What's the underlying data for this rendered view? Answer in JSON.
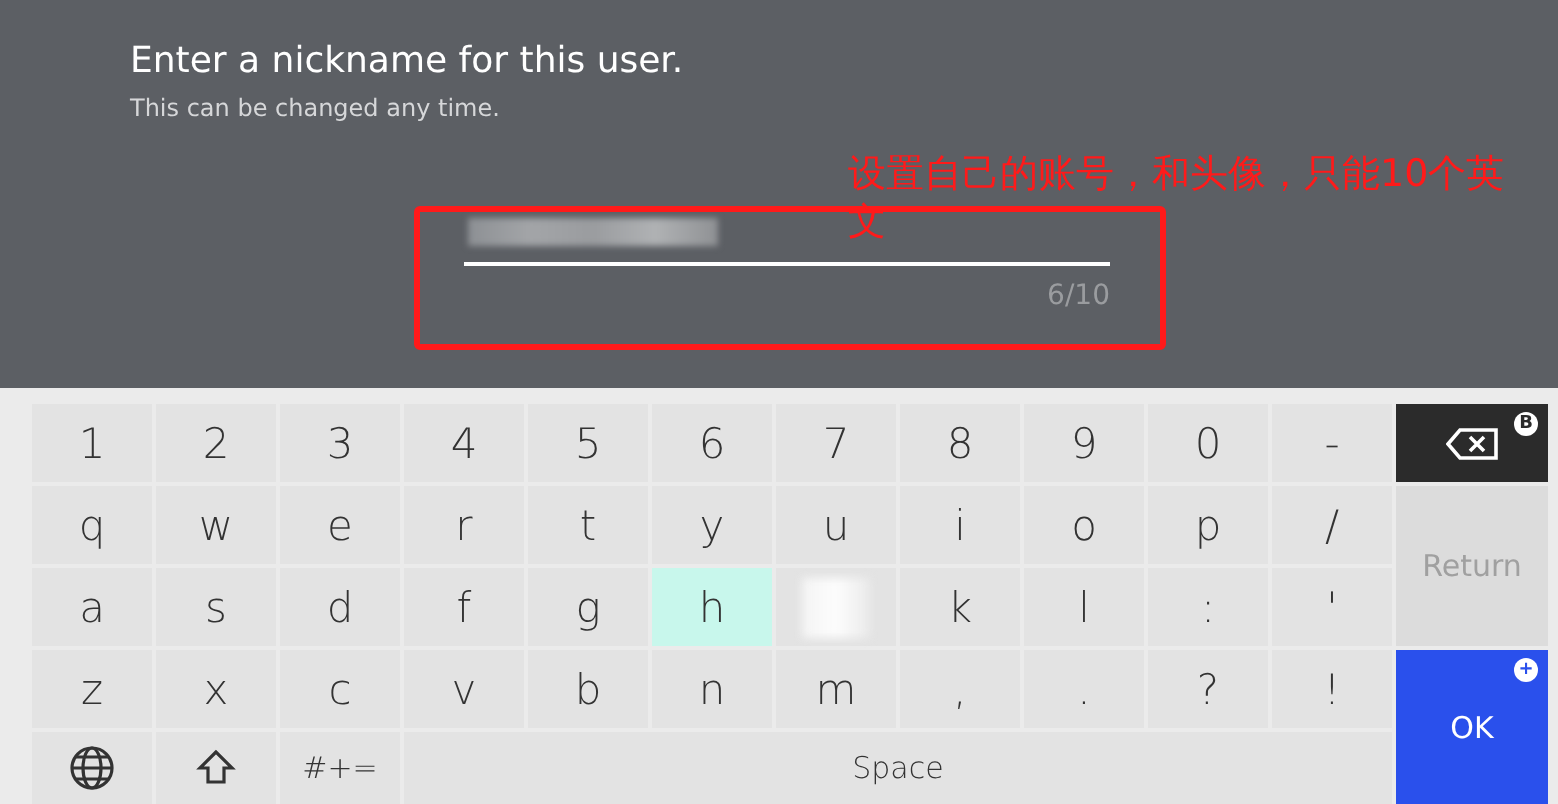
{
  "prompt": {
    "title": "Enter a nickname for this user.",
    "subtitle": "This can be changed any time."
  },
  "nickname_field": {
    "counter": "6/10"
  },
  "annotation": {
    "text": "设置自己的账号，和头像，只能10个英文"
  },
  "keyboard": {
    "rows": [
      [
        {
          "label": "1",
          "selected": false
        },
        {
          "label": "2",
          "selected": false
        },
        {
          "label": "3",
          "selected": false
        },
        {
          "label": "4",
          "selected": false
        },
        {
          "label": "5",
          "selected": false
        },
        {
          "label": "6",
          "selected": false
        },
        {
          "label": "7",
          "selected": false
        },
        {
          "label": "8",
          "selected": false
        },
        {
          "label": "9",
          "selected": false
        },
        {
          "label": "0",
          "selected": false
        },
        {
          "label": "-",
          "selected": false
        }
      ],
      [
        {
          "label": "q",
          "selected": false
        },
        {
          "label": "w",
          "selected": false
        },
        {
          "label": "e",
          "selected": false
        },
        {
          "label": "r",
          "selected": false
        },
        {
          "label": "t",
          "selected": false
        },
        {
          "label": "y",
          "selected": false
        },
        {
          "label": "u",
          "selected": false
        },
        {
          "label": "i",
          "selected": false
        },
        {
          "label": "o",
          "selected": false
        },
        {
          "label": "p",
          "selected": false
        },
        {
          "label": "/",
          "selected": false
        }
      ],
      [
        {
          "label": "a",
          "selected": false
        },
        {
          "label": "s",
          "selected": false
        },
        {
          "label": "d",
          "selected": false
        },
        {
          "label": "f",
          "selected": false
        },
        {
          "label": "g",
          "selected": false
        },
        {
          "label": "h",
          "selected": true
        },
        {
          "selected": false
        },
        {
          "label": "k",
          "selected": false
        },
        {
          "label": "l",
          "selected": false
        },
        {
          "label": ":",
          "selected": false
        },
        {
          "label": "'",
          "selected": false
        }
      ],
      [
        {
          "label": "z",
          "selected": false
        },
        {
          "label": "x",
          "selected": false
        },
        {
          "label": "c",
          "selected": false
        },
        {
          "label": "v",
          "selected": false
        },
        {
          "label": "b",
          "selected": false
        },
        {
          "label": "n",
          "selected": false
        },
        {
          "label": "m",
          "selected": false
        },
        {
          "label": ",",
          "selected": false
        },
        {
          "label": ".",
          "selected": false
        },
        {
          "label": "?",
          "selected": false
        },
        {
          "label": "!",
          "selected": false
        }
      ]
    ],
    "bottom_row": [
      {
        "kind": "globe"
      },
      {
        "kind": "shift"
      },
      {
        "kind": "text",
        "label": "#+="
      },
      {
        "kind": "space",
        "label": "Space"
      }
    ],
    "side_keys": [
      {
        "kind": "backspace",
        "badge": "B",
        "disabled": false
      },
      {
        "kind": "return",
        "label": "Return",
        "disabled": true
      },
      {
        "kind": "ok",
        "label": "OK",
        "badge": "+",
        "disabled": false
      }
    ]
  }
}
